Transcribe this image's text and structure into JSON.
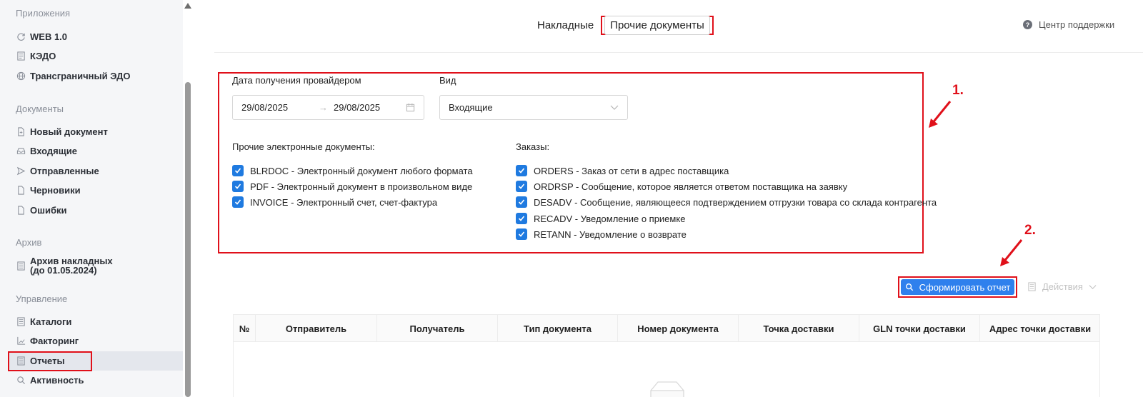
{
  "sidebar": {
    "sections": {
      "apps": "Приложения",
      "documents": "Документы",
      "archive": "Архив",
      "management": "Управление"
    },
    "items": {
      "web": "WEB 1.0",
      "kedo": "КЭДО",
      "cross_border": "Трансграничный ЭДО",
      "new_doc": "Новый документ",
      "incoming": "Входящие",
      "sent": "Отправленные",
      "drafts": "Черновики",
      "errors": "Ошибки",
      "archive_line1": "Архив накладных",
      "archive_line2": "(до 01.05.2024)",
      "catalogs": "Каталоги",
      "factoring": "Факторинг",
      "reports": "Отчеты",
      "activity": "Активность"
    }
  },
  "tabs": {
    "waybills": "Накладные",
    "other_docs": "Прочие документы"
  },
  "support": "Центр поддержки",
  "filters": {
    "date_label": "Дата получения провайдером",
    "date_from": "29/08/2025",
    "date_to": "29/08/2025",
    "date_arrow": "→",
    "type_label": "Вид",
    "type_value": "Входящие",
    "other_edocs_label": "Прочие электронные документы:",
    "orders_label": "Заказы:",
    "other_edocs": [
      "BLRDOC - Электронный документ любого формата",
      "PDF - Электронный документ в произвольном виде",
      "INVOICE - Электронный счет, счет-фактура"
    ],
    "orders": [
      "ORDERS - Заказ от сети в адрес поставщика",
      "ORDRSP - Сообщение, которое является ответом поставщика на заявку",
      "DESADV - Сообщение, являющееся подтверждением отгрузки товара со склада контрагента",
      "RECADV - Уведомление о приемке",
      "RETANN - Уведомление о возврате"
    ]
  },
  "annotations": {
    "one": "1.",
    "two": "2."
  },
  "buttons": {
    "generate_report": "Сформировать отчет",
    "actions": "Действия"
  },
  "table": {
    "headers": [
      "№",
      "Отправитель",
      "Получатель",
      "Тип документа",
      "Номер документа",
      "Точка доставки",
      "GLN точки доставки",
      "Адрес точки доставки"
    ]
  },
  "colors": {
    "accent": "#2f80ed",
    "checkbox": "#1f7ae0",
    "annotation_red": "#e0101a",
    "sidebar_bg": "#f5f6f8"
  }
}
